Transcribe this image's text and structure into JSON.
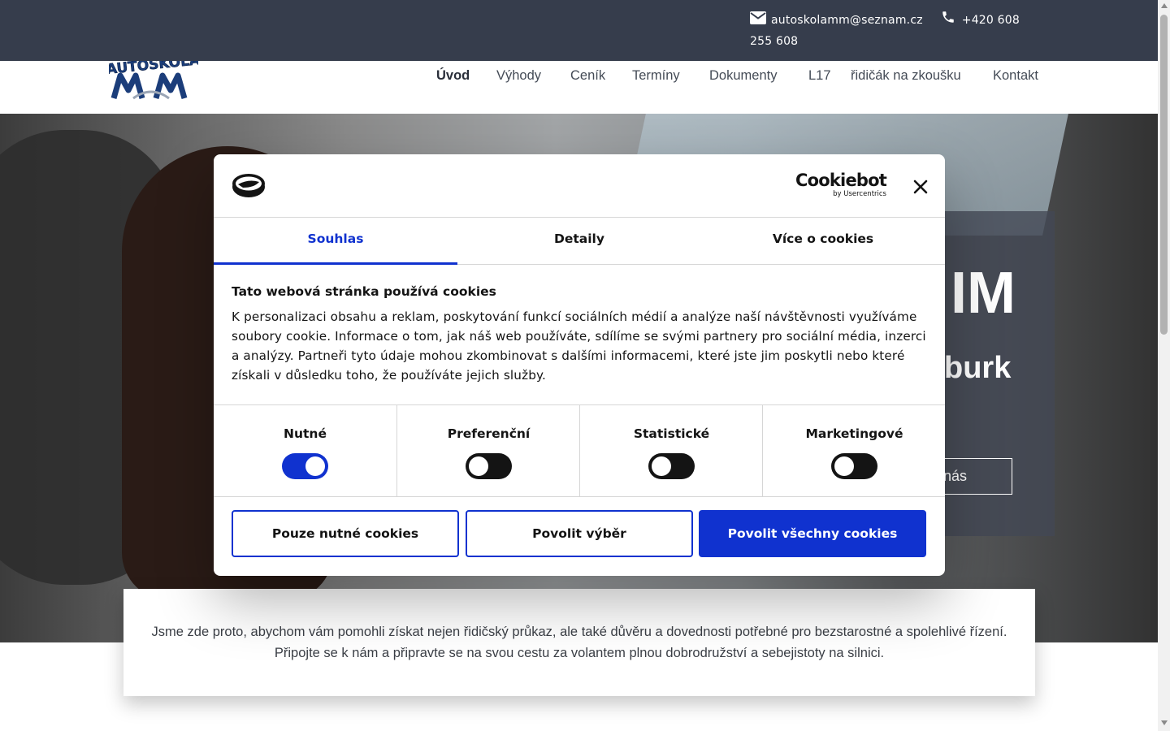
{
  "topbar": {
    "email": "autoskolamm@seznam.cz",
    "phone": "+420 608 255 608",
    "email_icon": "mail-icon",
    "phone_icon": "phone-icon"
  },
  "logo": {
    "text": "AUTOŠKOLA",
    "mark": "MM"
  },
  "nav": {
    "items": [
      {
        "label": "Úvod",
        "active": true
      },
      {
        "label": "Výhody"
      },
      {
        "label": "Ceník"
      },
      {
        "label": "Termíny"
      },
      {
        "label": "Dokumenty"
      },
      {
        "label": "L17"
      },
      {
        "label": "řidičák na zkoušku"
      },
      {
        "label": "Kontakt"
      }
    ]
  },
  "hero": {
    "title_fragment": "IM",
    "subtitle_fragment": "burk",
    "cta_fragment": "nás"
  },
  "intro": {
    "text": "Jsme zde proto, abychom vám pomohli získat nejen řidičský průkaz, ale také důvěru a dovednosti potřebné pro bezstarostné a spolehlivé řízení. Připojte se k nám a připravte se na svou cestu za volantem plnou dobrodružství a sebejistoty na silnici."
  },
  "cookie": {
    "brand": "Cookiebot",
    "brand_by": "by Usercentrics",
    "tabs": [
      "Souhlas",
      "Detaily",
      "Více o cookies"
    ],
    "active_tab": "Souhlas",
    "heading": "Tato webová stránka používá cookies",
    "body": "K personalizaci obsahu a reklam, poskytování funkcí sociálních médií a analýze naší návštěvnosti využíváme soubory cookie. Informace o tom, jak náš web používáte, sdílíme se svými partnery pro sociální média, inzerci a analýzy. Partneři tyto údaje mohou zkombinovat s dalšími informacemi, které jste jim poskytli nebo které získali v důsledku toho, že používáte jejich služby.",
    "categories": [
      {
        "label": "Nutné",
        "on": true
      },
      {
        "label": "Preferenční",
        "on": false
      },
      {
        "label": "Statistické",
        "on": false
      },
      {
        "label": "Marketingové",
        "on": false
      }
    ],
    "buttons": {
      "necessary_only": "Pouze nutné cookies",
      "allow_selection": "Povolit výběr",
      "allow_all": "Povolit všechny cookies"
    },
    "accent_color": "#1032cf"
  }
}
